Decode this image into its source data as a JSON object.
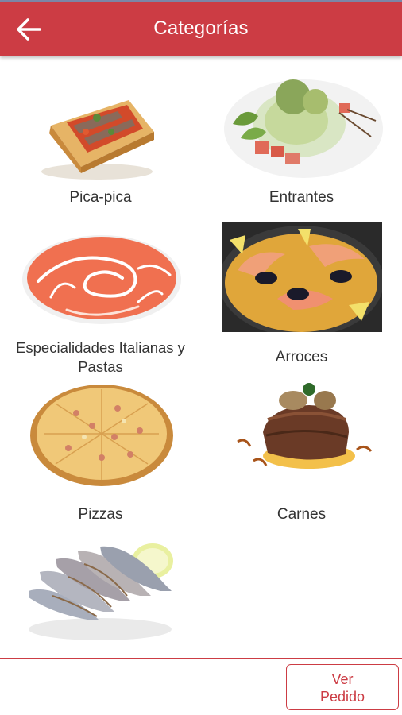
{
  "header": {
    "title": "Categorías",
    "back_icon": "arrow-left-icon",
    "background_color": "#cc3c44"
  },
  "categories": [
    {
      "label": "Pica-pica",
      "image": "tapas-bread-anchovy"
    },
    {
      "label": "Entrantes",
      "image": "salad-starter"
    },
    {
      "label": "Especialidades Italianas y Pastas",
      "image": "tomato-soup-cream"
    },
    {
      "label": "Arroces",
      "image": "seafood-paella"
    },
    {
      "label": "Pizzas",
      "image": "pizza"
    },
    {
      "label": "Carnes",
      "image": "steak-mushrooms"
    },
    {
      "label": "",
      "image": "fried-sardines-lemon"
    }
  ],
  "footer": {
    "order_button_label": "Ver\nPedido",
    "accent_color": "#cc3c44"
  }
}
